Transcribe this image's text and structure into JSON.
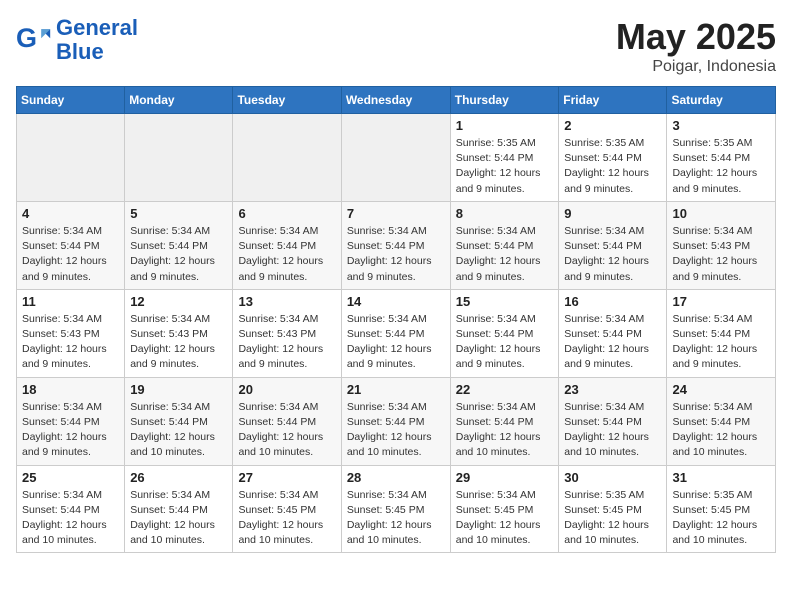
{
  "header": {
    "logo_line1": "General",
    "logo_line2": "Blue",
    "month": "May 2025",
    "location": "Poigar, Indonesia"
  },
  "weekdays": [
    "Sunday",
    "Monday",
    "Tuesday",
    "Wednesday",
    "Thursday",
    "Friday",
    "Saturday"
  ],
  "weeks": [
    [
      {
        "day": "",
        "info": ""
      },
      {
        "day": "",
        "info": ""
      },
      {
        "day": "",
        "info": ""
      },
      {
        "day": "",
        "info": ""
      },
      {
        "day": "1",
        "info": "Sunrise: 5:35 AM\nSunset: 5:44 PM\nDaylight: 12 hours\nand 9 minutes."
      },
      {
        "day": "2",
        "info": "Sunrise: 5:35 AM\nSunset: 5:44 PM\nDaylight: 12 hours\nand 9 minutes."
      },
      {
        "day": "3",
        "info": "Sunrise: 5:35 AM\nSunset: 5:44 PM\nDaylight: 12 hours\nand 9 minutes."
      }
    ],
    [
      {
        "day": "4",
        "info": "Sunrise: 5:34 AM\nSunset: 5:44 PM\nDaylight: 12 hours\nand 9 minutes."
      },
      {
        "day": "5",
        "info": "Sunrise: 5:34 AM\nSunset: 5:44 PM\nDaylight: 12 hours\nand 9 minutes."
      },
      {
        "day": "6",
        "info": "Sunrise: 5:34 AM\nSunset: 5:44 PM\nDaylight: 12 hours\nand 9 minutes."
      },
      {
        "day": "7",
        "info": "Sunrise: 5:34 AM\nSunset: 5:44 PM\nDaylight: 12 hours\nand 9 minutes."
      },
      {
        "day": "8",
        "info": "Sunrise: 5:34 AM\nSunset: 5:44 PM\nDaylight: 12 hours\nand 9 minutes."
      },
      {
        "day": "9",
        "info": "Sunrise: 5:34 AM\nSunset: 5:44 PM\nDaylight: 12 hours\nand 9 minutes."
      },
      {
        "day": "10",
        "info": "Sunrise: 5:34 AM\nSunset: 5:43 PM\nDaylight: 12 hours\nand 9 minutes."
      }
    ],
    [
      {
        "day": "11",
        "info": "Sunrise: 5:34 AM\nSunset: 5:43 PM\nDaylight: 12 hours\nand 9 minutes."
      },
      {
        "day": "12",
        "info": "Sunrise: 5:34 AM\nSunset: 5:43 PM\nDaylight: 12 hours\nand 9 minutes."
      },
      {
        "day": "13",
        "info": "Sunrise: 5:34 AM\nSunset: 5:43 PM\nDaylight: 12 hours\nand 9 minutes."
      },
      {
        "day": "14",
        "info": "Sunrise: 5:34 AM\nSunset: 5:44 PM\nDaylight: 12 hours\nand 9 minutes."
      },
      {
        "day": "15",
        "info": "Sunrise: 5:34 AM\nSunset: 5:44 PM\nDaylight: 12 hours\nand 9 minutes."
      },
      {
        "day": "16",
        "info": "Sunrise: 5:34 AM\nSunset: 5:44 PM\nDaylight: 12 hours\nand 9 minutes."
      },
      {
        "day": "17",
        "info": "Sunrise: 5:34 AM\nSunset: 5:44 PM\nDaylight: 12 hours\nand 9 minutes."
      }
    ],
    [
      {
        "day": "18",
        "info": "Sunrise: 5:34 AM\nSunset: 5:44 PM\nDaylight: 12 hours\nand 9 minutes."
      },
      {
        "day": "19",
        "info": "Sunrise: 5:34 AM\nSunset: 5:44 PM\nDaylight: 12 hours\nand 10 minutes."
      },
      {
        "day": "20",
        "info": "Sunrise: 5:34 AM\nSunset: 5:44 PM\nDaylight: 12 hours\nand 10 minutes."
      },
      {
        "day": "21",
        "info": "Sunrise: 5:34 AM\nSunset: 5:44 PM\nDaylight: 12 hours\nand 10 minutes."
      },
      {
        "day": "22",
        "info": "Sunrise: 5:34 AM\nSunset: 5:44 PM\nDaylight: 12 hours\nand 10 minutes."
      },
      {
        "day": "23",
        "info": "Sunrise: 5:34 AM\nSunset: 5:44 PM\nDaylight: 12 hours\nand 10 minutes."
      },
      {
        "day": "24",
        "info": "Sunrise: 5:34 AM\nSunset: 5:44 PM\nDaylight: 12 hours\nand 10 minutes."
      }
    ],
    [
      {
        "day": "25",
        "info": "Sunrise: 5:34 AM\nSunset: 5:44 PM\nDaylight: 12 hours\nand 10 minutes."
      },
      {
        "day": "26",
        "info": "Sunrise: 5:34 AM\nSunset: 5:44 PM\nDaylight: 12 hours\nand 10 minutes."
      },
      {
        "day": "27",
        "info": "Sunrise: 5:34 AM\nSunset: 5:45 PM\nDaylight: 12 hours\nand 10 minutes."
      },
      {
        "day": "28",
        "info": "Sunrise: 5:34 AM\nSunset: 5:45 PM\nDaylight: 12 hours\nand 10 minutes."
      },
      {
        "day": "29",
        "info": "Sunrise: 5:34 AM\nSunset: 5:45 PM\nDaylight: 12 hours\nand 10 minutes."
      },
      {
        "day": "30",
        "info": "Sunrise: 5:35 AM\nSunset: 5:45 PM\nDaylight: 12 hours\nand 10 minutes."
      },
      {
        "day": "31",
        "info": "Sunrise: 5:35 AM\nSunset: 5:45 PM\nDaylight: 12 hours\nand 10 minutes."
      }
    ]
  ]
}
